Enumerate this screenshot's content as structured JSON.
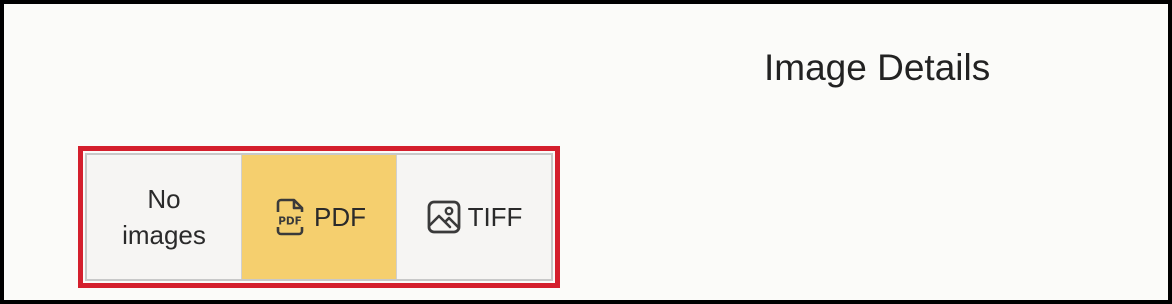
{
  "header": {
    "title": "Image Details"
  },
  "format_selector": {
    "options": [
      {
        "label": "No images",
        "icon": null,
        "selected": false
      },
      {
        "label": "PDF",
        "icon": "pdf-file-icon",
        "selected": true
      },
      {
        "label": "TIFF",
        "icon": "image-icon",
        "selected": false
      }
    ]
  },
  "colors": {
    "selected_bg": "#f5cf6e",
    "highlight_border": "#d41f2d",
    "option_bg": "#f6f5f3"
  }
}
